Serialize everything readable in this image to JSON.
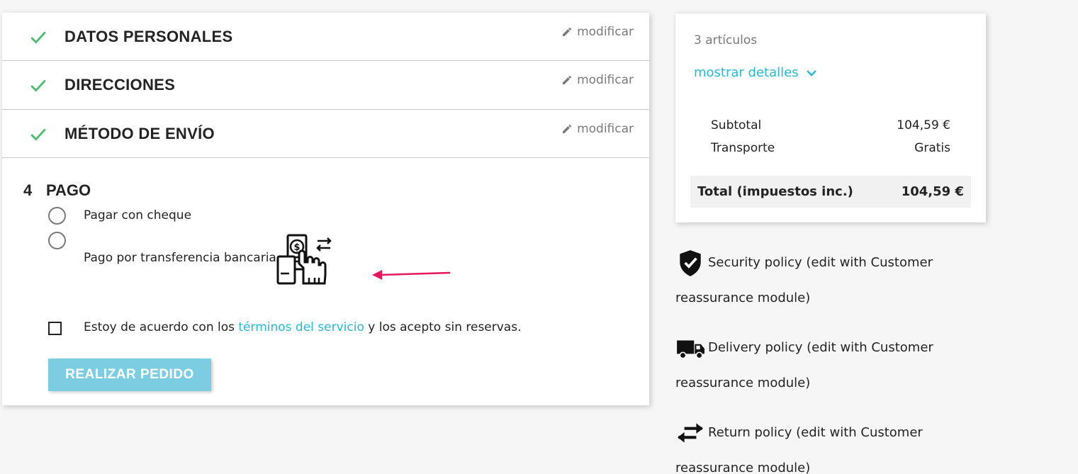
{
  "steps": [
    {
      "title": "DATOS PERSONALES",
      "edit": "modificar"
    },
    {
      "title": "DIRECCIONES",
      "edit": "modificar"
    },
    {
      "title": "MÉTODO DE ENVÍO",
      "edit": "modificar"
    }
  ],
  "payment": {
    "number": "4",
    "title": "PAGO",
    "options": [
      "Pagar con cheque",
      "Pago por transferencia bancaria"
    ],
    "terms_before": "Estoy de acuerdo con los ",
    "terms_link": "términos del servicio",
    "terms_after": " y los acepto sin reservas.",
    "order_button": "REALIZAR PEDIDO"
  },
  "summary": {
    "items": "3 artículos",
    "details": "mostrar detalles",
    "subtotal_label": "Subtotal",
    "subtotal_value": "104,59 €",
    "shipping_label": "Transporte",
    "shipping_value": "Gratis",
    "total_label": "Total (impuestos inc.)",
    "total_value": "104,59 €"
  },
  "reassurance": [
    {
      "icon": "shield-check-icon",
      "text": "Security policy (edit with Customer reassurance module)"
    },
    {
      "icon": "truck-icon",
      "text": "Delivery policy (edit with Customer reassurance module)"
    },
    {
      "icon": "swap-arrows-icon",
      "text": "Return policy (edit with Customer reassurance module)"
    }
  ],
  "colors": {
    "accent": "#24b9d7",
    "check": "#4cbb6c",
    "button": "#7ccde2",
    "arrow": "#e8175d"
  }
}
